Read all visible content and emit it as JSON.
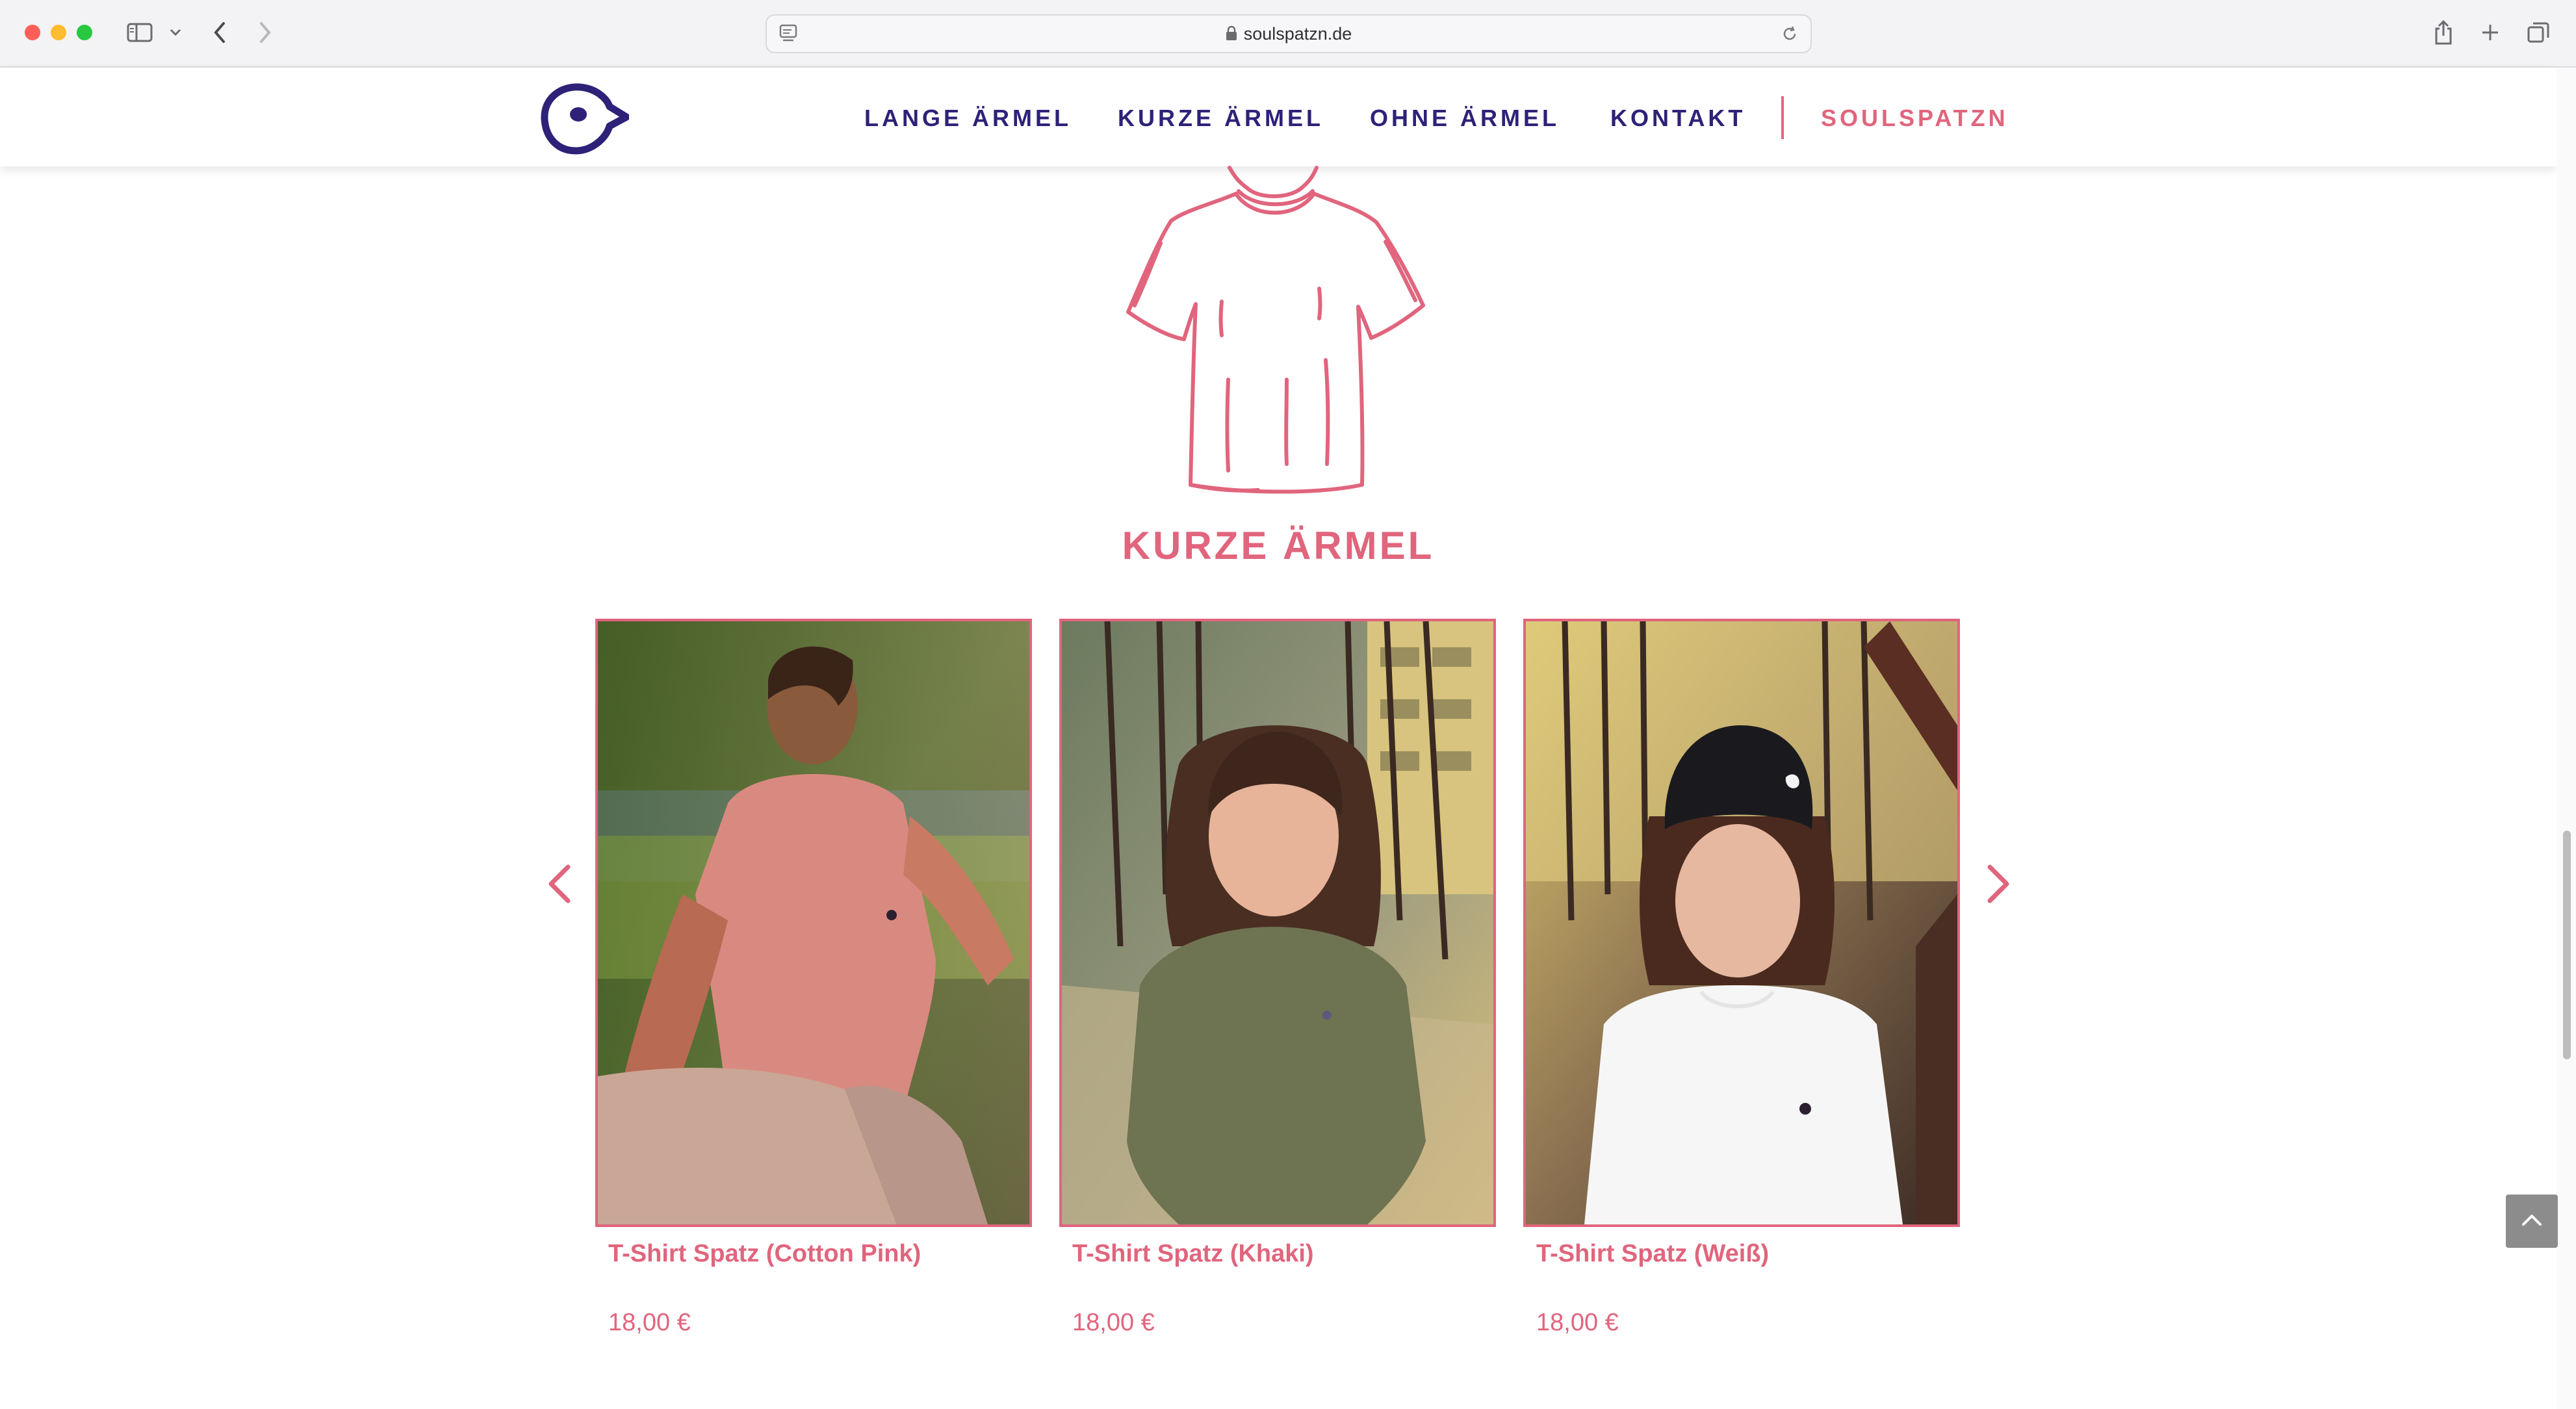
{
  "browser": {
    "url": "soulspatzn.de",
    "icons": [
      "sidebar-icon",
      "chevron-down-icon",
      "back-icon",
      "forward-icon",
      "reader-icon",
      "lock-icon",
      "reload-icon",
      "share-icon",
      "new-tab-icon",
      "tabs-overview-icon"
    ]
  },
  "nav": {
    "items": [
      {
        "label": "LANGE ÄRMEL"
      },
      {
        "label": "KURZE ÄRMEL"
      },
      {
        "label": "OHNE ÄRMEL"
      },
      {
        "label": "KONTAKT"
      }
    ],
    "brand_link": "SOULSPATZN"
  },
  "section": {
    "title": "KURZE ÄRMEL"
  },
  "products": [
    {
      "name": "T-Shirt Spatz (Cotton Pink)",
      "price": "18,00 €"
    },
    {
      "name": "T-Shirt Spatz (Khaki)",
      "price": "18,00 €"
    },
    {
      "name": "T-Shirt Spatz (Weiß)",
      "price": "18,00 €"
    }
  ],
  "colors": {
    "brand_navy": "#2d2278",
    "accent_pink": "#e0657d"
  }
}
